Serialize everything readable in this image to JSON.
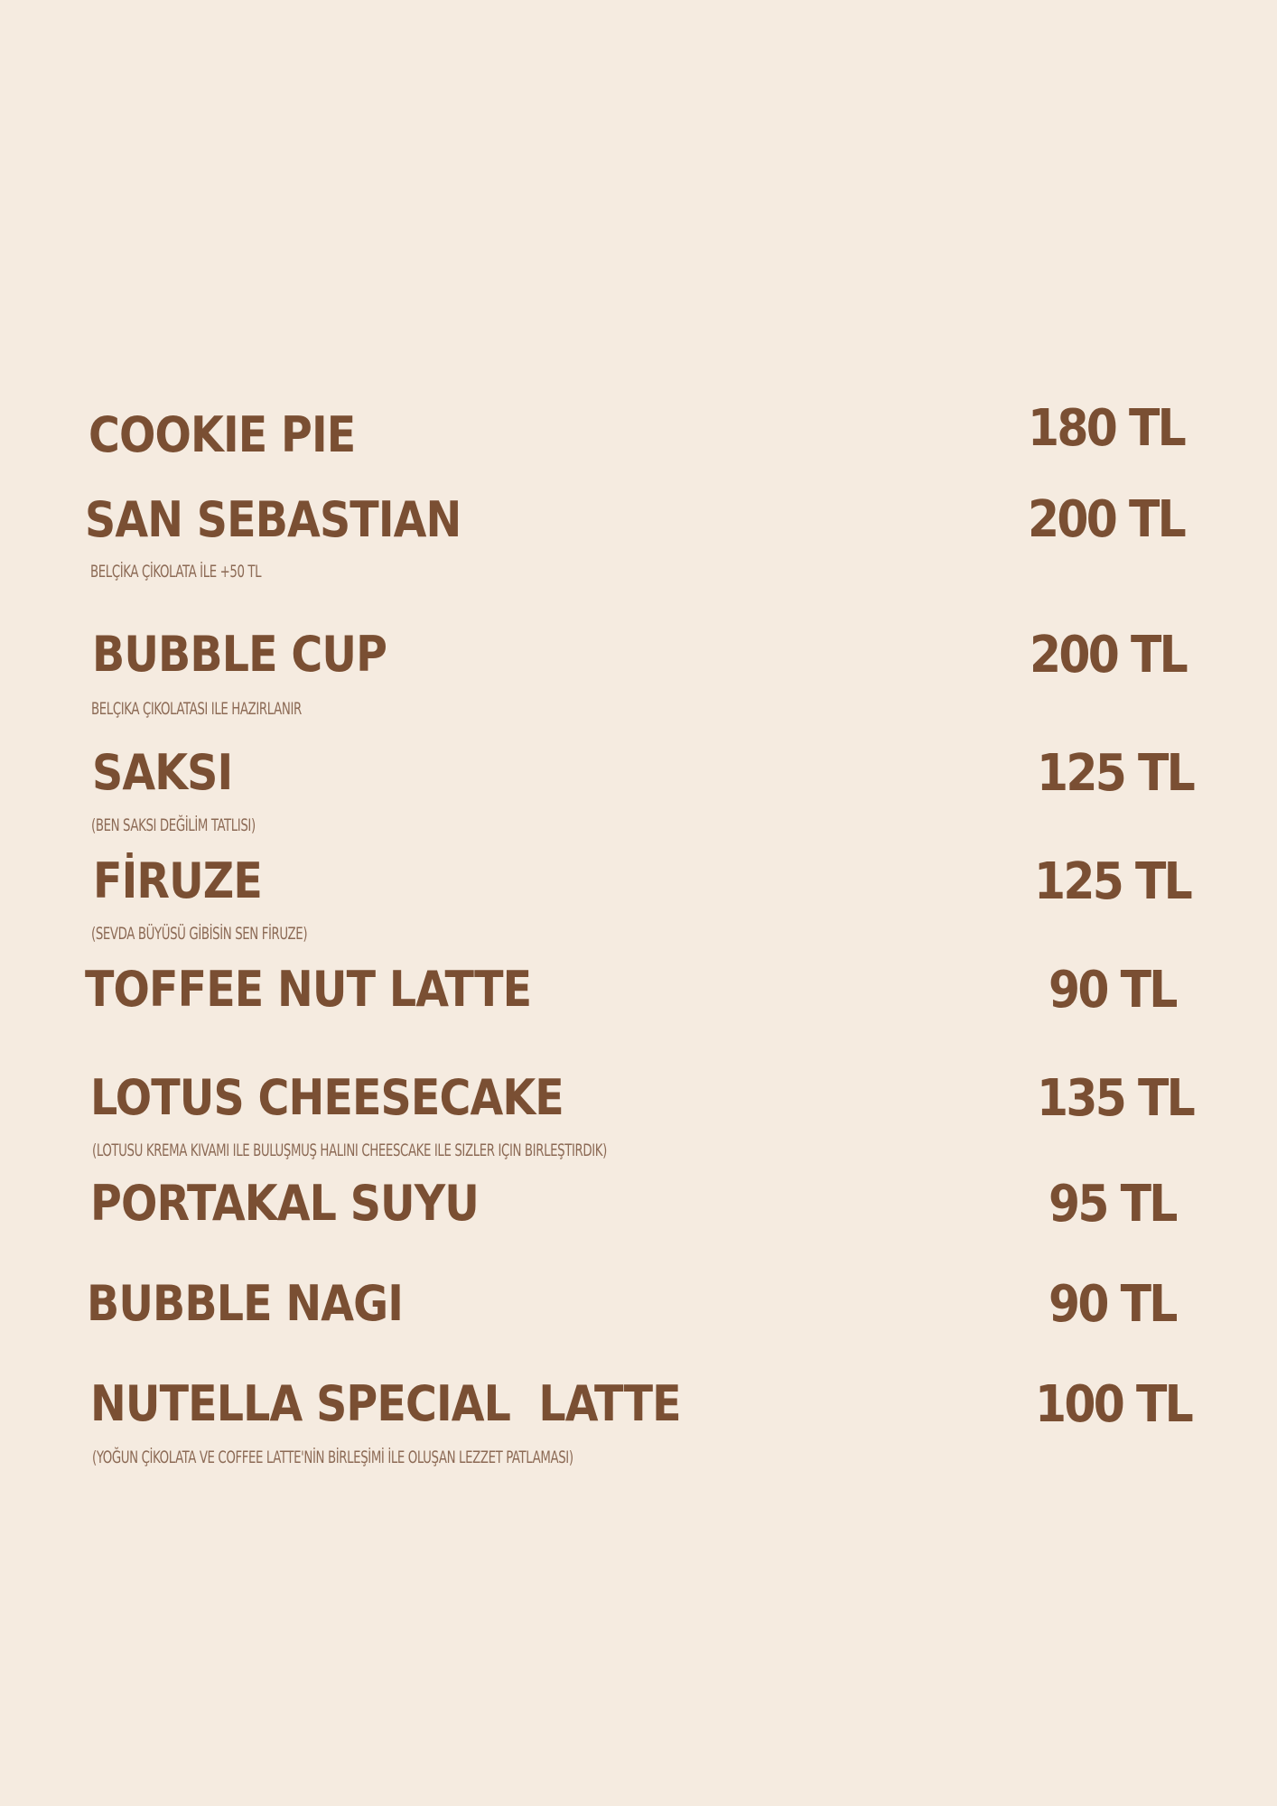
{
  "menu": {
    "items": [
      {
        "name": "COOKIE PIE",
        "price": "180 TL",
        "note": ""
      },
      {
        "name": "SAN SEBASTIAN",
        "price": "200 TL",
        "note": "BELÇİKA ÇİKOLATA İLE +50 TL"
      },
      {
        "name": "BUBBLE CUP",
        "price": "200 TL",
        "note": "BELÇIKA ÇIKOLATASI ILE HAZIRLANIR"
      },
      {
        "name": "SAKSI",
        "price": "125 TL",
        "note": "(BEN SAKSI DEĞİLİM TATLISI)"
      },
      {
        "name": "FİRUZE",
        "price": "125 TL",
        "note": "(SEVDA BÜYÜSÜ GİBİSİN SEN FİRUZE)"
      },
      {
        "name": "TOFFEE NUT LATTE",
        "price": "90 TL",
        "note": ""
      },
      {
        "name": "LOTUS CHEESECAKE",
        "price": "135 TL",
        "note": "(LOTUSU KREMA KIVAMI ILE BULUŞMUŞ HALINI CHEESCAKE ILE SIZLER IÇIN BIRLEŞTIRDIK)"
      },
      {
        "name": "PORTAKAL SUYU",
        "price": "95 TL",
        "note": ""
      },
      {
        "name": "BUBBLE NAGI",
        "price": "90 TL",
        "note": ""
      },
      {
        "name": "NUTELLA SPECIAL  LATTE",
        "price": "100 TL",
        "note": "(YOĞUN ÇİKOLATA VE COFFEE LATTE'NİN BİRLEŞİMİ İLE OLUŞAN LEZZET PATLAMASI)"
      }
    ]
  },
  "colors": {
    "background": "#f5ebe0",
    "text": "#7a4f33",
    "note": "#8c6a55"
  }
}
